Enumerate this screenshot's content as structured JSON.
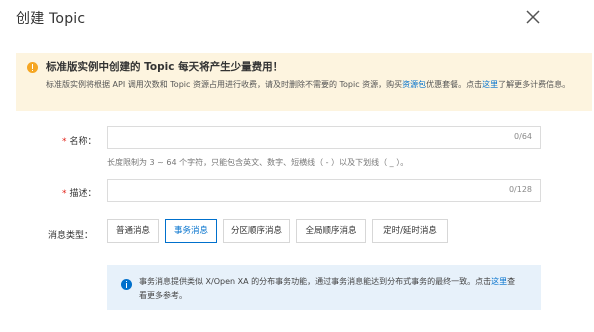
{
  "dialog": {
    "title": "创建 Topic",
    "close_icon": "close-icon"
  },
  "warning": {
    "icon": "warning-icon",
    "title": "标准版实例中创建的 Topic 每天将产生少量费用！",
    "body_part1": "标准版实例将根据 API 调用次数和 Topic 资源占用进行收费，请及时删除不需要的 Topic 资源，购买",
    "link_package": "资源包",
    "body_part2": "优惠套餐。点击",
    "link_here": "这里",
    "body_part3": "了解更多计费信息。"
  },
  "form": {
    "name": {
      "required_mark": "*",
      "label": "名称：",
      "value": "",
      "counter": "0/64",
      "hint": "长度限制为 3 ~ 64 个字符，只能包含英文、数字、短横线（ - ）以及下划线（ _ ）。"
    },
    "description": {
      "required_mark": "*",
      "label": "描述：",
      "value": "",
      "counter": "0/128"
    },
    "message_type": {
      "label": "消息类型：",
      "options": [
        "普通消息",
        "事务消息",
        "分区顺序消息",
        "全局顺序消息",
        "定时/延时消息"
      ],
      "selected": "事务消息"
    }
  },
  "info": {
    "icon": "info-icon",
    "body_part1": "事务消息提供类似 X/Open XA 的分布事务功能，通过事务消息能达到分布式事务的最终一致。点击",
    "link_here": "这里",
    "body_part2": "查看更多参考。"
  },
  "colors": {
    "accent": "#0070cc",
    "warning_bg": "#fdf4df",
    "warning_icon": "#f5a623",
    "info_bg": "#e7f1fa",
    "required": "#e2231a"
  }
}
